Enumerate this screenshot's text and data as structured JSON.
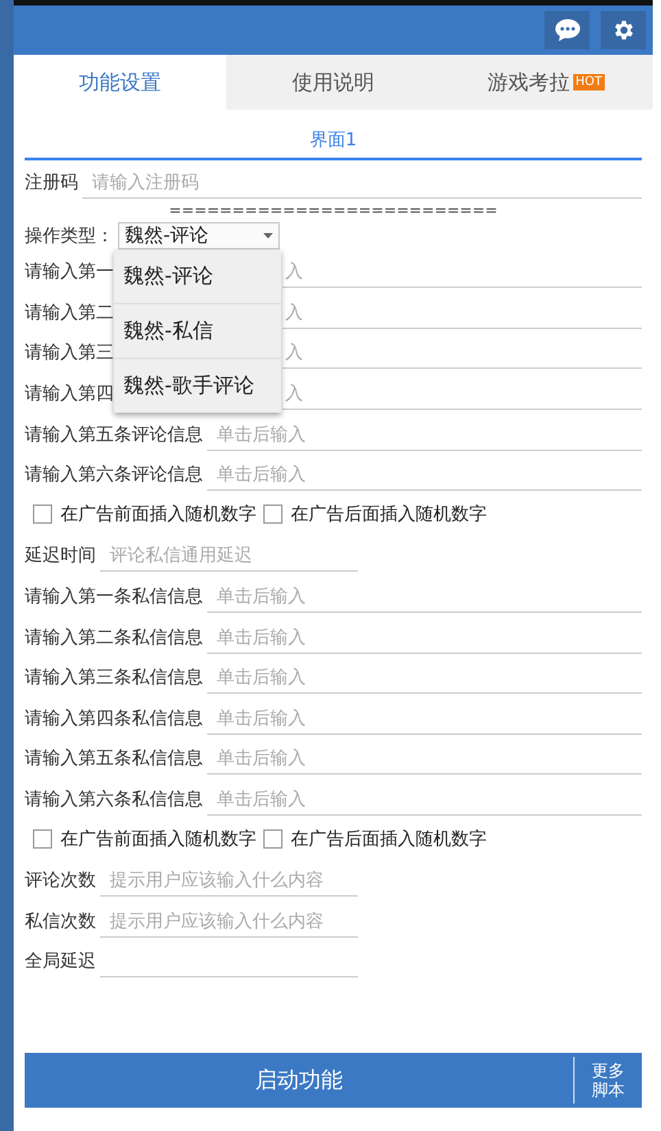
{
  "tabs": [
    {
      "label": "功能设置",
      "selected": true
    },
    {
      "label": "使用说明",
      "selected": false
    },
    {
      "label": "游戏考拉",
      "selected": false,
      "badge": "HOT"
    }
  ],
  "section_title": "界面1",
  "rows": [
    {
      "kind": "field",
      "label": "注册码",
      "placeholder": "请输入注册码"
    },
    {
      "kind": "separator",
      "text": "=========================="
    },
    {
      "kind": "select",
      "label": "操作类型：",
      "value": "魏然-评论",
      "expanded": true,
      "options": [
        {
          "label": "魏然-评论"
        },
        {
          "label": "魏然-私信"
        },
        {
          "label": "魏然-歌手评论"
        }
      ]
    },
    {
      "kind": "covered_field",
      "label": "请输入第一",
      "placeholder": "入"
    },
    {
      "kind": "covered_field",
      "label": "请输入第二",
      "placeholder": "入"
    },
    {
      "kind": "covered_field",
      "label": "请输入第三",
      "placeholder": "入"
    },
    {
      "kind": "covered_field",
      "label": "请输入第四",
      "placeholder": "入"
    },
    {
      "kind": "field",
      "label": "请输入第五条评论信息",
      "placeholder": "单击后输入"
    },
    {
      "kind": "field",
      "label": "请输入第六条评论信息",
      "placeholder": "单击后输入"
    },
    {
      "kind": "checkboxes",
      "items": [
        {
          "label": "在广告前面插入随机数字",
          "checked": false
        },
        {
          "label": "在广告后面插入随机数字",
          "checked": false
        }
      ]
    },
    {
      "kind": "short_field",
      "label": "延迟时间",
      "placeholder": "评论私信通用延迟"
    },
    {
      "kind": "field",
      "label": "请输入第一条私信信息",
      "placeholder": "单击后输入"
    },
    {
      "kind": "field",
      "label": "请输入第二条私信信息",
      "placeholder": "单击后输入"
    },
    {
      "kind": "field",
      "label": "请输入第三条私信信息",
      "placeholder": "单击后输入"
    },
    {
      "kind": "field",
      "label": "请输入第四条私信信息",
      "placeholder": "单击后输入"
    },
    {
      "kind": "field",
      "label": "请输入第五条私信信息",
      "placeholder": "单击后输入"
    },
    {
      "kind": "field",
      "label": "请输入第六条私信信息",
      "placeholder": "单击后输入"
    },
    {
      "kind": "checkboxes",
      "items": [
        {
          "label": "在广告前面插入随机数字",
          "checked": false
        },
        {
          "label": "在广告后面插入随机数字",
          "checked": false
        }
      ]
    },
    {
      "kind": "short_field",
      "label": "评论次数",
      "placeholder": "提示用户应该输入什么内容"
    },
    {
      "kind": "short_field",
      "label": "私信次数",
      "placeholder": "提示用户应该输入什么内容"
    },
    {
      "kind": "short_field",
      "label": "全局延迟"
    }
  ],
  "buttons": {
    "start": "启动功能",
    "more": "更多脚本"
  }
}
